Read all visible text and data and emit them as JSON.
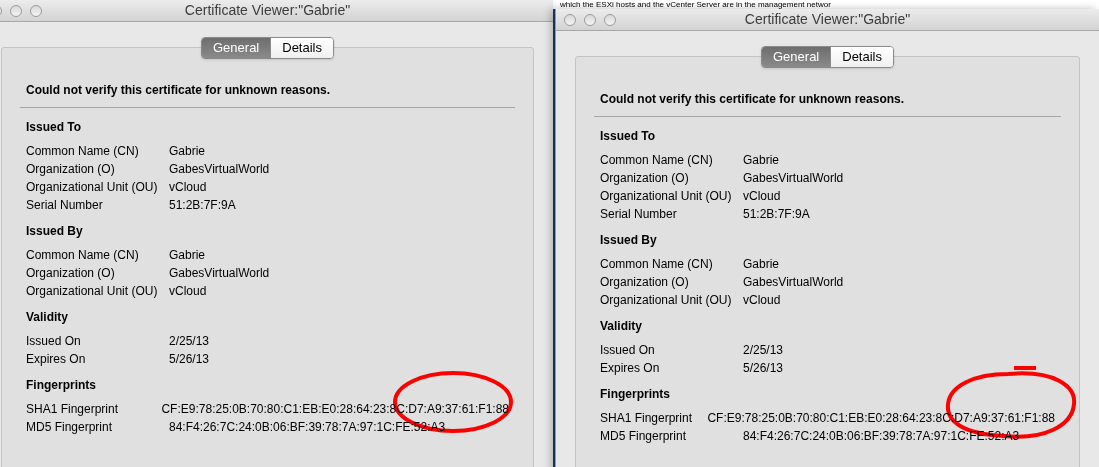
{
  "background_text": "which the ESXi hosts and the vCenter Server are in the management networ",
  "windows": [
    {
      "title": "Certificate Viewer:\"Gabrie\"",
      "tabs": [
        {
          "label": "General",
          "selected": true
        },
        {
          "label": "Details",
          "selected": false
        }
      ],
      "warning": "Could not verify this certificate for unknown reasons.",
      "sections": [
        {
          "heading": "Issued To",
          "rows": [
            {
              "label": "Common Name (CN)",
              "value": "Gabrie"
            },
            {
              "label": "Organization (O)",
              "value": "GabesVirtualWorld"
            },
            {
              "label": "Organizational Unit (OU)",
              "value": "vCloud"
            },
            {
              "label": "Serial Number",
              "value": "51:2B:7F:9A"
            }
          ]
        },
        {
          "heading": "Issued By",
          "rows": [
            {
              "label": "Common Name (CN)",
              "value": "Gabrie"
            },
            {
              "label": "Organization (O)",
              "value": "GabesVirtualWorld"
            },
            {
              "label": "Organizational Unit (OU)",
              "value": "vCloud"
            }
          ]
        },
        {
          "heading": "Validity",
          "rows": [
            {
              "label": "Issued On",
              "value": "2/25/13"
            },
            {
              "label": "Expires On",
              "value": "5/26/13"
            }
          ]
        },
        {
          "heading": "Fingerprints",
          "rows": [
            {
              "label": "SHA1 Fingerprint",
              "value": "CF:E9:78:25:0B:70:80:C1:EB:E0:28:64:23:8C:D7:A9:37:61:F1:88"
            },
            {
              "label": "MD5 Fingerprint",
              "value": "84:F4:26:7C:24:0B:06:BF:39:78:7A:97:1C:FE:52:A3"
            }
          ]
        }
      ]
    },
    {
      "title": "Certificate Viewer:\"Gabrie\"",
      "tabs": [
        {
          "label": "General",
          "selected": true
        },
        {
          "label": "Details",
          "selected": false
        }
      ],
      "warning": "Could not verify this certificate for unknown reasons.",
      "sections": [
        {
          "heading": "Issued To",
          "rows": [
            {
              "label": "Common Name (CN)",
              "value": "Gabrie"
            },
            {
              "label": "Organization (O)",
              "value": "GabesVirtualWorld"
            },
            {
              "label": "Organizational Unit (OU)",
              "value": "vCloud"
            },
            {
              "label": "Serial Number",
              "value": "51:2B:7F:9A"
            }
          ]
        },
        {
          "heading": "Issued By",
          "rows": [
            {
              "label": "Common Name (CN)",
              "value": "Gabrie"
            },
            {
              "label": "Organization (O)",
              "value": "GabesVirtualWorld"
            },
            {
              "label": "Organizational Unit (OU)",
              "value": "vCloud"
            }
          ]
        },
        {
          "heading": "Validity",
          "rows": [
            {
              "label": "Issued On",
              "value": "2/25/13"
            },
            {
              "label": "Expires On",
              "value": "5/26/13"
            }
          ]
        },
        {
          "heading": "Fingerprints",
          "rows": [
            {
              "label": "SHA1 Fingerprint",
              "value": "CF:E9:78:25:0B:70:80:C1:EB:E0:28:64:23:8C:D7:A9:37:61:F1:88"
            },
            {
              "label": "MD5 Fingerprint",
              "value": "84:F4:26:7C:24:0B:06:BF:39:78:7A:97:1C:FE:52:A3"
            }
          ]
        }
      ]
    }
  ]
}
